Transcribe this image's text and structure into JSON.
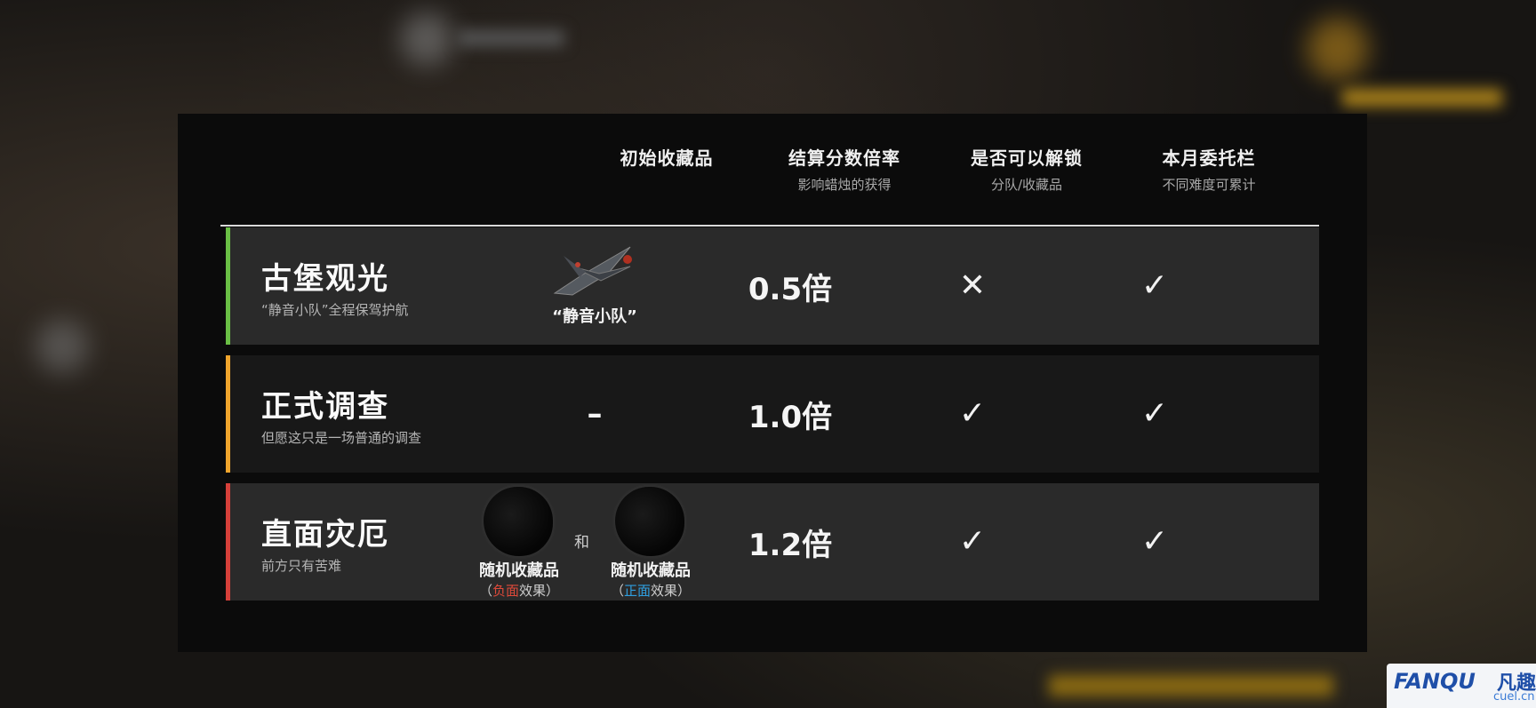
{
  "header": {
    "columns": [
      {
        "title": "初始收藏品",
        "subtitle": ""
      },
      {
        "title": "结算分数倍率",
        "subtitle": "影响蜡烛的获得"
      },
      {
        "title": "是否可以解锁",
        "subtitle": "分队/收藏品"
      },
      {
        "title": "本月委托栏",
        "subtitle": "不同难度可累计"
      }
    ]
  },
  "rows": [
    {
      "name": "古堡观光",
      "desc": "“静音小队”全程保驾护航",
      "accent": "#6abf45",
      "item_label": "“静音小队”",
      "multiplier": "0.5倍",
      "unlock": "✕",
      "commission": "✓"
    },
    {
      "name": "正式调查",
      "desc": "但愿这只是一场普通的调查",
      "accent": "#f0a52c",
      "item_label": "–",
      "multiplier": "1.0倍",
      "unlock": "✓",
      "commission": "✓"
    },
    {
      "name": "直面灾厄",
      "desc": "前方只有苦难",
      "accent": "#d6403a",
      "item_a_label": "随机收藏品",
      "item_a_paren_open": "（",
      "item_a_effect_word": "负面",
      "item_a_effect_rest": "效果）",
      "item_and": "和",
      "item_b_label": "随机收藏品",
      "item_b_paren_open": "（",
      "item_b_effect_word": "正面",
      "item_b_effect_rest": "效果）",
      "multiplier": "1.2倍",
      "unlock": "✓",
      "commission": "✓"
    }
  ],
  "watermark": {
    "brand": "FANQU",
    "cn": "凡趣",
    "domain": "cuel.cn"
  }
}
